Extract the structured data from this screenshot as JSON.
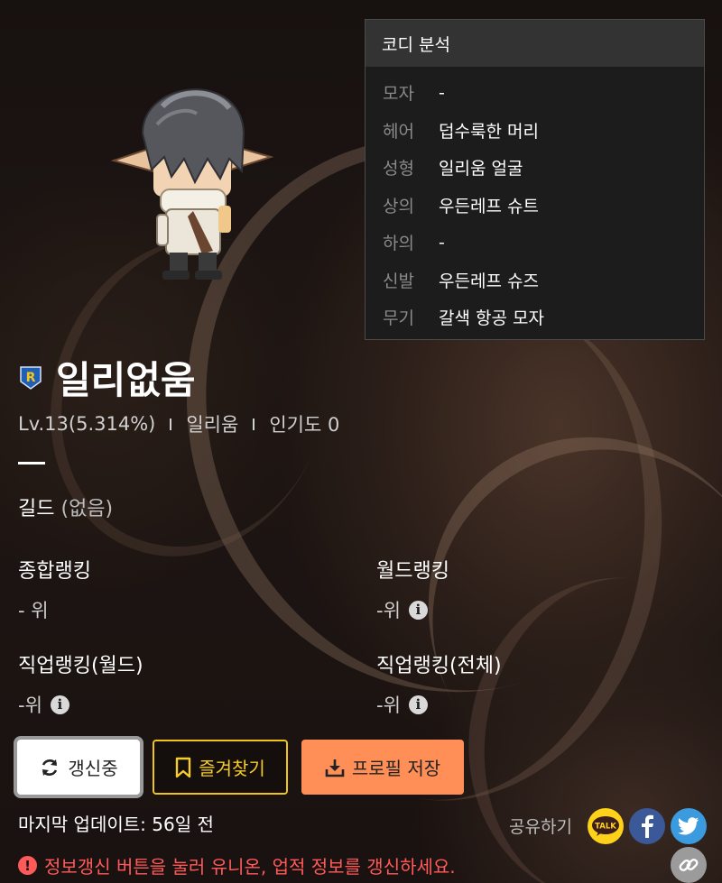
{
  "codi": {
    "title": "코디 분석",
    "items": [
      {
        "key": "모자",
        "value": "-"
      },
      {
        "key": "헤어",
        "value": "덥수룩한 머리"
      },
      {
        "key": "성형",
        "value": "일리움 얼굴"
      },
      {
        "key": "상의",
        "value": "우든레프 슈트"
      },
      {
        "key": "하의",
        "value": "-"
      },
      {
        "key": "신발",
        "value": "우든레프 슈즈"
      },
      {
        "key": "무기",
        "value": "갈색 항공 모자"
      }
    ]
  },
  "character": {
    "name": "일리없움",
    "level": "Lv.13(5.314%)",
    "job": "일리움",
    "popularity": "인기도 0",
    "guild_label": "길드",
    "guild_value": "(없음)"
  },
  "rankings": {
    "overall": {
      "label": "종합랭킹",
      "value": "- 위"
    },
    "world": {
      "label": "월드랭킹",
      "value": "-위"
    },
    "job_world": {
      "label": "직업랭킹(월드)",
      "value": "-위"
    },
    "job_all": {
      "label": "직업랭킹(전체)",
      "value": "-위"
    }
  },
  "buttons": {
    "refresh": "갱신중",
    "favorite": "즐겨찾기",
    "save_profile": "프로필 저장"
  },
  "last_update": "마지막 업데이트: 56일 전",
  "share": {
    "label": "공유하기",
    "kakao": "TALK"
  },
  "notice": "정보갱신 버튼을 눌러 유니온, 업적 정보를 갱신하세요.",
  "colors": {
    "accent_yellow": "#f0c419",
    "accent_orange": "#ff8f57",
    "notice_red": "#ff5a5a"
  },
  "icons": [
    "world-reboot-icon",
    "refresh-icon",
    "bookmark-icon",
    "download-icon",
    "info-icon",
    "kakao-talk-icon",
    "facebook-icon",
    "twitter-icon",
    "link-icon",
    "warning-icon"
  ]
}
